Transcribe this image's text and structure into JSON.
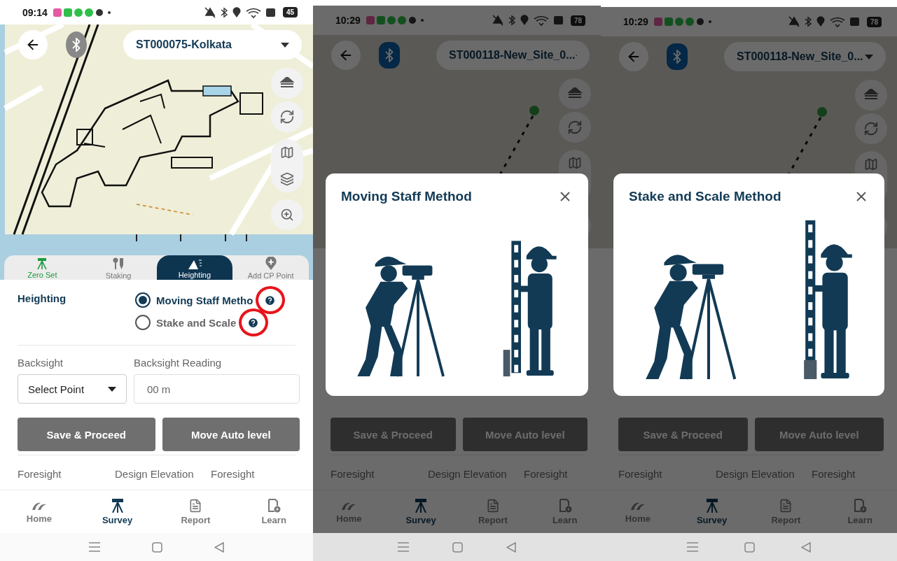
{
  "screens": [
    {
      "status_bar": {
        "time": "09:14",
        "battery": "45"
      },
      "bluetooth": {
        "connected": false
      },
      "site": "ST000075-Kolkata",
      "map": {
        "kind": "site_plan"
      },
      "tools": [
        {
          "label": "Zero Set",
          "kind": "zero",
          "selected": false,
          "completed": true
        },
        {
          "label": "Staking",
          "kind": "staking",
          "selected": false,
          "completed": false
        },
        {
          "label": "Heighting",
          "kind": "heighting",
          "selected": true,
          "completed": false
        },
        {
          "label": "Add CP Point",
          "kind": "add",
          "selected": false,
          "completed": false
        }
      ],
      "heighting": {
        "label": "Heighting",
        "methods": [
          {
            "label": "Moving Staff Metho",
            "selected": true,
            "highlighted": true
          },
          {
            "label": "Stake and Scale",
            "selected": false,
            "highlighted": true
          }
        ]
      },
      "backsight": {
        "label": "Backsight",
        "select": "Select Point",
        "reading_label": "Backsight Reading",
        "reading_placeholder": "00 m"
      },
      "actions": [
        "Save & Proceed",
        "Move Auto level"
      ],
      "foresight_headers": [
        "Foresight",
        "Design Elevation",
        "Foresight"
      ],
      "nav": [
        {
          "label": "Home",
          "kind": "home",
          "selected": false
        },
        {
          "label": "Survey",
          "kind": "survey",
          "selected": true
        },
        {
          "label": "Report",
          "kind": "report",
          "selected": false
        },
        {
          "label": "Learn",
          "kind": "learn",
          "selected": false
        }
      ]
    },
    {
      "status_bar": {
        "time": "10:29",
        "battery": "78"
      },
      "bluetooth": {
        "connected": true
      },
      "site": "ST000118-New_Site_0...",
      "map": {
        "kind": "track"
      },
      "actions": [
        "Save & Proceed",
        "Move Auto level"
      ],
      "foresight_headers": [
        "Foresight",
        "Design Elevation",
        "Foresight"
      ],
      "nav": [
        {
          "label": "Home",
          "kind": "home",
          "selected": false
        },
        {
          "label": "Survey",
          "kind": "survey",
          "selected": true
        },
        {
          "label": "Report",
          "kind": "report",
          "selected": false
        },
        {
          "label": "Learn",
          "kind": "learn",
          "selected": false
        }
      ],
      "modal": {
        "title": "Moving Staff Method",
        "kind": "moving_staff"
      }
    },
    {
      "status_bar": {
        "time": "10:29",
        "battery": "78"
      },
      "bluetooth": {
        "connected": true
      },
      "site": "ST000118-New_Site_0...",
      "map": {
        "kind": "track"
      },
      "actions": [
        "Save & Proceed",
        "Move Auto level"
      ],
      "foresight_headers": [
        "Foresight",
        "Design Elevation",
        "Foresight"
      ],
      "nav": [
        {
          "label": "Home",
          "kind": "home",
          "selected": false
        },
        {
          "label": "Survey",
          "kind": "survey",
          "selected": true
        },
        {
          "label": "Report",
          "kind": "report",
          "selected": false
        },
        {
          "label": "Learn",
          "kind": "learn",
          "selected": false
        }
      ],
      "modal": {
        "title": "Stake and Scale Method",
        "kind": "stake_scale"
      }
    }
  ]
}
